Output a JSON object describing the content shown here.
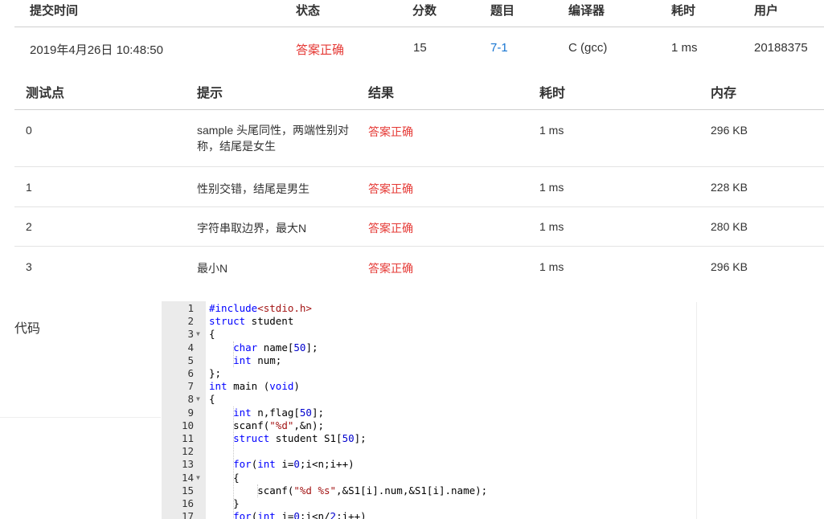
{
  "submission": {
    "headers": {
      "time": "提交时间",
      "status": "状态",
      "score": "分数",
      "problem": "题目",
      "compiler": "编译器",
      "elapsed": "耗时",
      "user": "用户"
    },
    "row": {
      "time": "2019年4月26日 10:48:50",
      "status": "答案正确",
      "score": "15",
      "problem": "7-1",
      "compiler": "C (gcc)",
      "elapsed": "1 ms",
      "user": "20188375"
    }
  },
  "testcases": {
    "headers": {
      "point": "测试点",
      "hint": "提示",
      "result": "结果",
      "elapsed": "耗时",
      "memory": "内存"
    },
    "rows": [
      {
        "point": "0",
        "hint": "sample 头尾同性，两端性别对称，结尾是女生",
        "result": "答案正确",
        "elapsed": "1 ms",
        "memory": "296 KB"
      },
      {
        "point": "1",
        "hint": "性别交错，结尾是男生",
        "result": "答案正确",
        "elapsed": "1 ms",
        "memory": "228 KB"
      },
      {
        "point": "2",
        "hint": "字符串取边界，最大N",
        "result": "答案正确",
        "elapsed": "1 ms",
        "memory": "280 KB"
      },
      {
        "point": "3",
        "hint": "最小N",
        "result": "答案正确",
        "elapsed": "1 ms",
        "memory": "296 KB"
      }
    ]
  },
  "code_section": {
    "label": "代码",
    "lines": [
      "#include<stdio.h>",
      "struct student",
      "{",
      "    char name[50];",
      "    int num;",
      "};",
      "int main (void)",
      "{",
      "    int n,flag[50];",
      "    scanf(\"%d\",&n);",
      "    struct student S1[50];",
      "",
      "    for(int i=0;i<n;i++)",
      "    {",
      "        scanf(\"%d %s\",&S1[i].num,&S1[i].name);",
      "    }",
      "    for(int i=0;i<n/2;i++)"
    ],
    "fold_lines": [
      3,
      8,
      14
    ]
  },
  "colors": {
    "accepted": "#e53935",
    "problem_link": "#1976d2",
    "gutter": "#ebebeb"
  }
}
